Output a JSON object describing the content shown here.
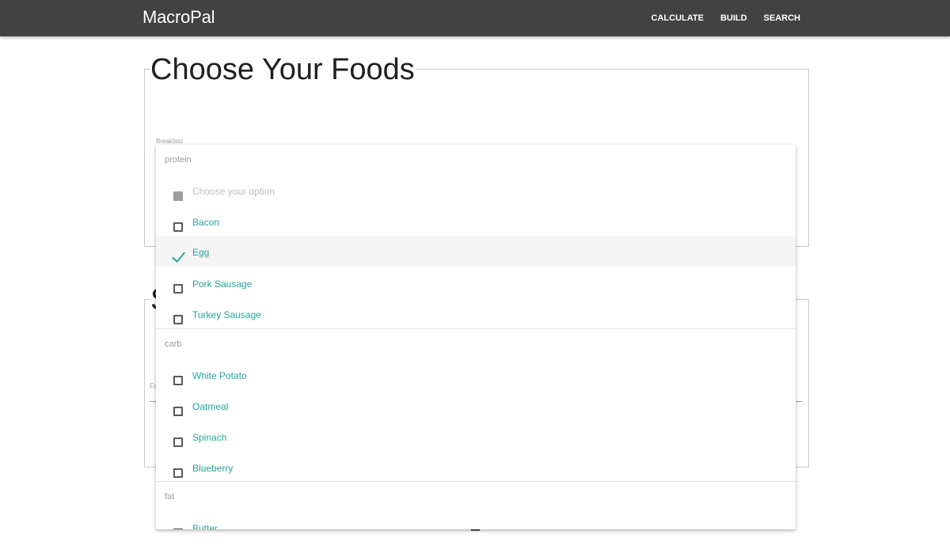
{
  "app": {
    "brand": "MacroPal",
    "nav": [
      "CALCULATE",
      "BUILD",
      "SEARCH"
    ]
  },
  "page": {
    "title": "Choose Your Foods",
    "second_section_title_visible": "S",
    "field_label": "Breakfast",
    "food_field_label_visible": "Fo"
  },
  "dropdown": {
    "groups": [
      {
        "header": "protein",
        "options": [
          {
            "label": "Choose your option",
            "state": "disabled"
          },
          {
            "label": "Bacon",
            "state": "unchecked"
          },
          {
            "label": "Egg",
            "state": "checked"
          },
          {
            "label": "Pork Sausage",
            "state": "unchecked"
          },
          {
            "label": "Turkey Sausage",
            "state": "unchecked"
          }
        ]
      },
      {
        "header": "carb",
        "options": [
          {
            "label": "White Potato",
            "state": "unchecked"
          },
          {
            "label": "Oatmeal",
            "state": "unchecked"
          },
          {
            "label": "Spinach",
            "state": "unchecked"
          },
          {
            "label": "Blueberry",
            "state": "unchecked"
          }
        ]
      },
      {
        "header": "fat",
        "options": [
          {
            "label": "Butter",
            "state": "unchecked"
          }
        ]
      }
    ]
  },
  "colors": {
    "navbar": "#424242",
    "accent": "#26a69a",
    "muted_text": "#9e9e9e",
    "selected_row": "#f5f5f5"
  }
}
